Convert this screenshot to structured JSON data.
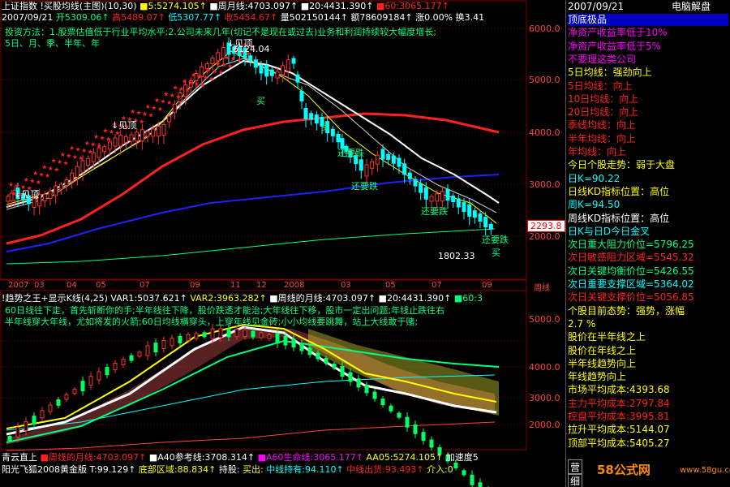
{
  "colors": {
    "bg": "#000000",
    "red": "#ff2020",
    "green": "#00ff80",
    "yellow": "#ffff00",
    "white": "#ffffff",
    "cyan": "#00ffff",
    "blue": "#2020ff",
    "magenta": "#ff00ff",
    "grid": "#800000"
  },
  "top_panel": {
    "title_row": [
      {
        "text": "上证指数",
        "color": "#ffffff"
      },
      {
        "text": "!买股均线(主图)(10,30)",
        "color": "#ffffff"
      },
      {
        "text": "■5:5274.105↑",
        "color": "#ffff00"
      },
      {
        "text": "■周月线:4703.097↑",
        "color": "#ffffff"
      },
      {
        "text": "■20:4431.390↑",
        "color": "#ffffff"
      },
      {
        "text": "■60:3065.177↑",
        "color": "#ff2020"
      }
    ],
    "info_row": [
      {
        "text": "2007/09/21",
        "color": "#ffffff"
      },
      {
        "text": "开5309.06↑",
        "color": "#00ff80"
      },
      {
        "text": "高5489.07↑",
        "color": "#ff2020"
      },
      {
        "text": "低5307.77↑",
        "color": "#00ffff"
      },
      {
        "text": "收5454.67↑",
        "color": "#ff2020"
      },
      {
        "text": "量502150144↑",
        "color": "#ffffff"
      },
      {
        "text": "额78609184↑",
        "color": "#ffffff"
      },
      {
        "text": "涨0.00%",
        "color": "#ffffff"
      },
      {
        "text": "换3.41",
        "color": "#ffffff"
      }
    ],
    "method_line1": "投资方法：1.股票估值低于行业平均水平;2.公司未来几年(切记不是现在或过去)业务和利润持续较大幅度增长;",
    "method_line2": "5日、月、季、半年、年",
    "y_ticks": [
      "6000.0",
      "5000.0",
      "4000.0",
      "3000.0",
      "2000.0"
    ],
    "last_price": "2293.8",
    "low_label": "1802.33",
    "peak_label": "6124.04",
    "annotations": [
      {
        "text": "↓见顶",
        "color": "#ffffff"
      },
      {
        "text": "↓见顶",
        "color": "#ffffff"
      },
      {
        "text": "↓见顶",
        "color": "#ffffff"
      },
      {
        "text": "买",
        "color": "#00ff80"
      },
      {
        "text": "买",
        "color": "#00ff80"
      },
      {
        "text": "还要跌",
        "color": "#00ff80"
      },
      {
        "text": "还要跌",
        "color": "#00ff80"
      },
      {
        "text": "还要跌",
        "color": "#00ff80"
      },
      {
        "text": "还要跌",
        "color": "#00ff80"
      },
      {
        "text": "买",
        "color": "#00ff80"
      }
    ]
  },
  "x_axis": [
    "2007",
    "03",
    "04",
    "05",
    "07",
    "09",
    "11",
    "12",
    "2008",
    "03",
    "05",
    "07",
    "09",
    "周线"
  ],
  "bottom_panel": {
    "title_row": [
      {
        "text": "!趋势之王+显示K线(4,25)",
        "color": "#ffffff"
      },
      {
        "text": "VAR1:5037.621↑",
        "color": "#ffffff"
      },
      {
        "text": "VAR2:3963.282↑",
        "color": "#ffff00"
      },
      {
        "text": "■周线的月线:4703.097↑",
        "color": "#ffffff"
      },
      {
        "text": "■20:4431.390↑",
        "color": "#ffffff"
      },
      {
        "text": "■60:3",
        "color": "#00ff80"
      }
    ],
    "text_line1": "60日线往下走，首先斩断你的手;半年线往下降，股价跌透才能治;大年线往下移，股市一定出问题;年线止跌往右",
    "text_line2": "半年线穿大年线，尤如将发的火箭;60日均线横穿头，上穿年线见金砖;小小均线要跳舞，站上大线敢于赌;",
    "y_ticks": [
      "5000.0",
      "4000.0",
      "3000.0",
      "2000.0"
    ]
  },
  "status_rows": {
    "row1": [
      {
        "text": "青云直上",
        "color": "#ffffff"
      },
      {
        "text": "■周线的月线:4703.097↑",
        "color": "#ff2020"
      },
      {
        "text": "■A40参考线:3708.314↑",
        "color": "#ffffff"
      },
      {
        "text": "■A60生命线:3065.177↑",
        "color": "#ff00ff"
      },
      {
        "text": "AA05:5274.105↑",
        "color": "#ffff00"
      },
      {
        "text": "加速度5",
        "color": "#ffffff"
      }
    ],
    "row2": [
      {
        "text": "阳光飞狐2008黄金版",
        "color": "#ffffff"
      },
      {
        "text": "T:99.129↑",
        "color": "#ffffff"
      },
      {
        "text": "底部区域:88.834↑",
        "color": "#ffff00"
      },
      {
        "text": "持股:",
        "color": "#ffffff"
      },
      {
        "text": "买出:",
        "color": "#ffff00"
      },
      {
        "text": "中线持有:94.110↑",
        "color": "#00ffff"
      },
      {
        "text": "中线出货:93.493↑",
        "color": "#ff2020"
      },
      {
        "text": "介入:0",
        "color": "#ffff00"
      }
    ]
  },
  "sidebar": {
    "date": "2007/09/21",
    "label": "电脑解盘",
    "lines": [
      {
        "text": "顶底极品",
        "color": "#ffffff",
        "bg": "#0000c0"
      },
      {
        "text": "净资产收益率低于10%",
        "color": "#ff00ff"
      },
      {
        "text": "净资产收益率低于5%",
        "color": "#ff00ff"
      },
      {
        "text": "不要理这类公司",
        "color": "#ff00ff"
      },
      {
        "text": "5日均线：强劲向上",
        "color": "#ffff00"
      },
      {
        "text": "5日均线：向上",
        "color": "#ff2020"
      },
      {
        "text": "10日均线：向上",
        "color": "#ff2020"
      },
      {
        "text": "20日均线：向上",
        "color": "#ff2020"
      },
      {
        "text": "季线均线：向上",
        "color": "#ff2020"
      },
      {
        "text": "半年均线：向上",
        "color": "#ff2020"
      },
      {
        "text": "年均线：向上",
        "color": "#ff2020"
      },
      {
        "text": "今日个股走势：弱于大盘",
        "color": "#ffff00"
      },
      {
        "text": "日K=90.22",
        "color": "#00ffff"
      },
      {
        "text": "日线KD指标位置：高位",
        "color": "#ffff00"
      },
      {
        "text": "周K=94.50",
        "color": "#00ffff"
      },
      {
        "text": "周线KD指标位置：高位",
        "color": "#ffffff"
      },
      {
        "text": "日K与日D今日金叉",
        "color": "#00ffff"
      },
      {
        "text": "次日重大阻力价位=5796.25",
        "color": "#00ff80"
      },
      {
        "text": "次日敏感阻力区域=5545.32",
        "color": "#ff2020"
      },
      {
        "text": "次日关键均衡价位=5426.55",
        "color": "#00ff80"
      },
      {
        "text": "次日重要支撑区域=5364.02",
        "color": "#00ffff"
      },
      {
        "text": "次日关键支撑价位=5056.85",
        "color": "#ff2020"
      },
      {
        "text": "个股目前态势：强势，涨幅",
        "color": "#ffff00"
      },
      {
        "text": "2.7 %",
        "color": "#ffff00"
      },
      {
        "text": "股价在半年线之上",
        "color": "#ffff00"
      },
      {
        "text": "股价在年线之上",
        "color": "#ffff00"
      },
      {
        "text": "半年线趋势向上",
        "color": "#ffff00"
      },
      {
        "text": "年线趋势向上",
        "color": "#ffff00"
      },
      {
        "text": "市场平均成本:4393.68",
        "color": "#ffff00"
      },
      {
        "text": "主力平均成本:2797.84",
        "color": "#ff2020"
      },
      {
        "text": "控盘平均成本:3995.81",
        "color": "#ff2020"
      },
      {
        "text": "拉升平均成本:5144.07",
        "color": "#ffff00"
      },
      {
        "text": "顶部平均成本:5405.27",
        "color": "#ffff00"
      }
    ],
    "tabs": [
      "营",
      "细"
    ],
    "watermark": "58公式网",
    "watermark_url": "www.58gu.com"
  }
}
